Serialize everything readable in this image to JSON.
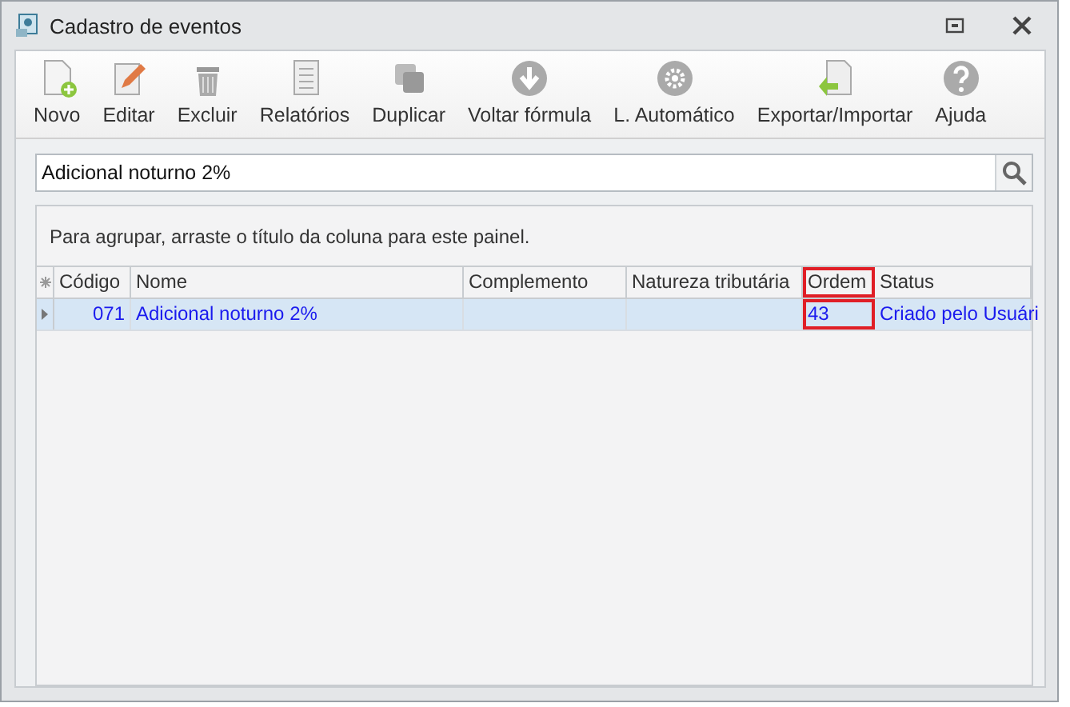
{
  "window": {
    "title": "Cadastro de eventos"
  },
  "toolbar": [
    {
      "label": "Novo",
      "kind": "new"
    },
    {
      "label": "Editar",
      "kind": "edit"
    },
    {
      "label": "Excluir",
      "kind": "delete"
    },
    {
      "label": "Relatórios",
      "kind": "report"
    },
    {
      "label": "Duplicar",
      "kind": "duplicate"
    },
    {
      "label": "Voltar fórmula",
      "kind": "back"
    },
    {
      "label": "L. Automático",
      "kind": "gear"
    },
    {
      "label": "Exportar/Importar",
      "kind": "export"
    },
    {
      "label": "Ajuda",
      "kind": "help"
    }
  ],
  "search": {
    "value": "Adicional noturno 2%"
  },
  "grid": {
    "group_hint": "Para agrupar, arraste o título da coluna para este painel.",
    "columns": [
      {
        "label": "Código",
        "highlighted": false
      },
      {
        "label": "Nome",
        "highlighted": false
      },
      {
        "label": "Complemento",
        "highlighted": false
      },
      {
        "label": "Natureza tributária",
        "highlighted": false
      },
      {
        "label": "Ordem",
        "highlighted": true
      },
      {
        "label": "Status",
        "highlighted": false
      }
    ],
    "rows": [
      {
        "selected": true,
        "cells": [
          "071",
          "Adicional noturno 2%",
          "",
          "",
          "43",
          "Criado pelo Usuári"
        ]
      }
    ]
  }
}
